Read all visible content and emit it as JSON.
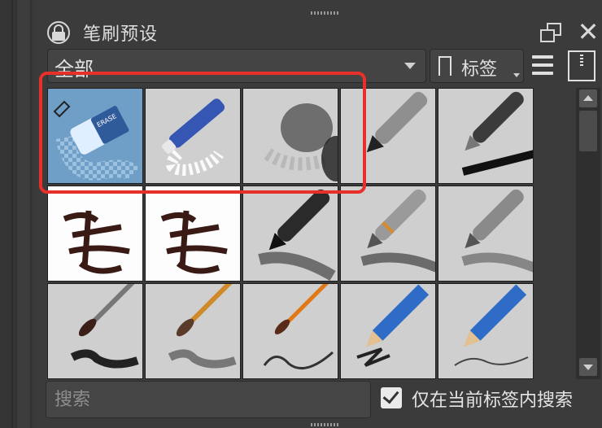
{
  "panel": {
    "title": "笔刷预设",
    "icons": [
      "lock-icon",
      "float-icon",
      "close-icon"
    ]
  },
  "filter": {
    "selected": "全部",
    "tag_label": "标签",
    "icons": [
      "bookmark-icon",
      "menu-icon",
      "storage-icon"
    ]
  },
  "presets": [
    {
      "name": "eraser-block",
      "selected": true
    },
    {
      "name": "eraser-pen"
    },
    {
      "name": "eraser-soft"
    },
    {
      "name": "airbrush-pen"
    },
    {
      "name": "ink-pen"
    },
    {
      "name": "calligraphy-1"
    },
    {
      "name": "calligraphy-2"
    },
    {
      "name": "marker-black"
    },
    {
      "name": "pen-silver-orange"
    },
    {
      "name": "pen-silver-grey"
    },
    {
      "name": "brush-dark"
    },
    {
      "name": "brush-orange-1"
    },
    {
      "name": "brush-orange-2"
    },
    {
      "name": "pencil-blue-1"
    },
    {
      "name": "pencil-blue-2"
    }
  ],
  "colors": {
    "highlight": "#e8302b",
    "selected_tile": "#6f9fc6"
  },
  "search": {
    "placeholder": "搜索",
    "value": ""
  },
  "filter_in_tag": {
    "label": "仅在当前标签内搜索",
    "checked": true
  }
}
